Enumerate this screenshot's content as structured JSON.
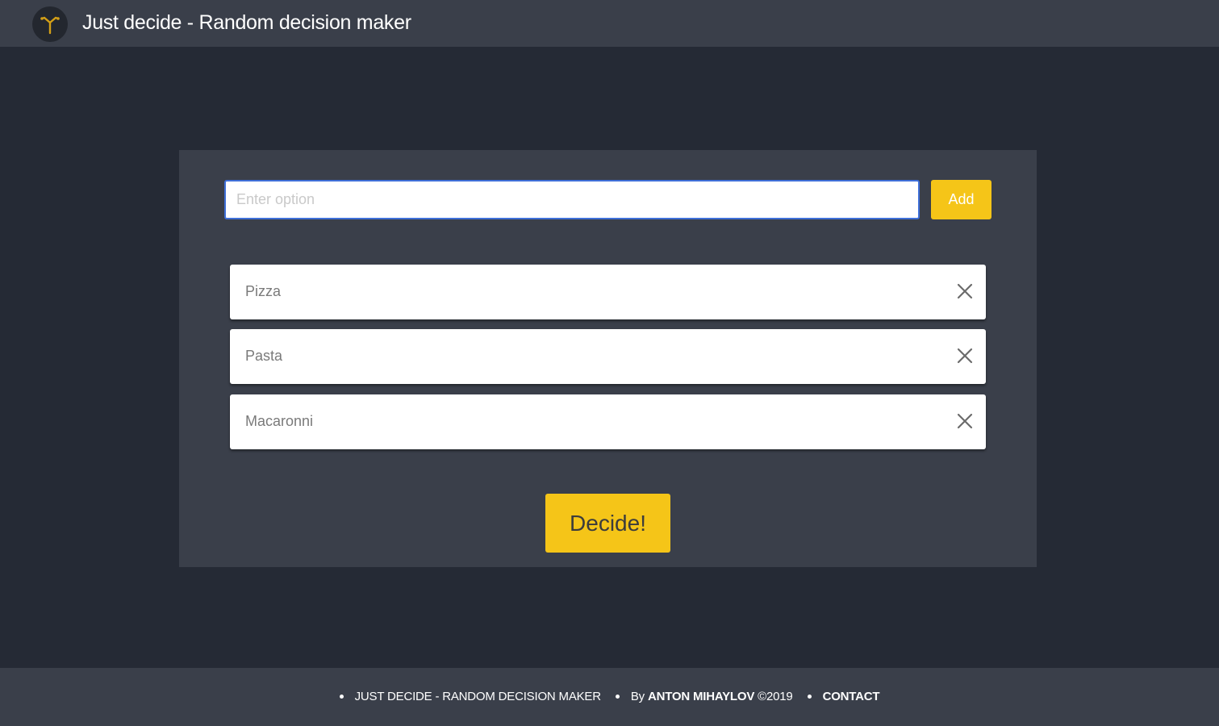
{
  "app": {
    "title": "Just decide - Random decision maker",
    "logo_icon": "tree-fork-icon",
    "accent_color": "#f5c518"
  },
  "input": {
    "placeholder": "Enter option",
    "value": "",
    "add_label": "Add"
  },
  "options": [
    {
      "label": "Pizza",
      "remove_icon": "close-icon"
    },
    {
      "label": "Pasta",
      "remove_icon": "close-icon"
    },
    {
      "label": "Macaronni",
      "remove_icon": "close-icon"
    }
  ],
  "decide_label": "Decide!",
  "footer": {
    "app_name": "JUST DECIDE - RANDOM DECISION MAKER",
    "by_prefix": "By",
    "author": "ANTON MIHAYLOV",
    "year": "©2019",
    "contact": "CONTACT"
  }
}
